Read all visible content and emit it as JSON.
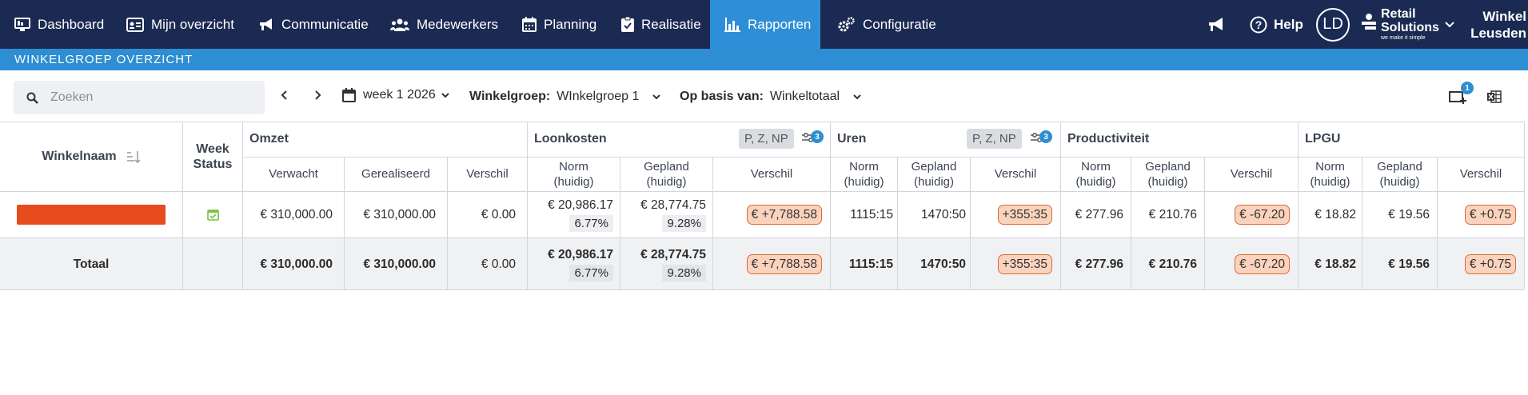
{
  "nav": {
    "items": [
      {
        "label": "Dashboard",
        "icon": "monitor-icon"
      },
      {
        "label": "Mijn overzicht",
        "icon": "id-card-icon"
      },
      {
        "label": "Communicatie",
        "icon": "megaphone-icon"
      },
      {
        "label": "Medewerkers",
        "icon": "users-icon"
      },
      {
        "label": "Planning",
        "icon": "calendar-icon"
      },
      {
        "label": "Realisatie",
        "icon": "clipboard-check-icon"
      },
      {
        "label": "Rapporten",
        "icon": "bar-chart-icon",
        "active": true
      },
      {
        "label": "Configuratie",
        "icon": "gears-icon"
      }
    ],
    "help_label": "Help",
    "avatar_initials": "LD",
    "brand_line1": "Retail",
    "brand_line2": "Solutions",
    "brand_tagline": "we make it simple",
    "store_line1": "Winkel",
    "store_line2": "Leusden"
  },
  "page": {
    "title": "WINKELGROEP OVERZICHT"
  },
  "toolbar": {
    "search_placeholder": "Zoeken",
    "week_label": "week 1 2026",
    "winkelgroep_label": "Winkelgroep:",
    "winkelgroep_value": "WInkelgroep 1",
    "basis_label": "Op basis van:",
    "basis_value": "Winkeltotaal",
    "notification_count": "1"
  },
  "table": {
    "col_winkelnaam": "Winkelnaam",
    "col_week": "Week",
    "col_status": "Status",
    "groups": {
      "omzet": "Omzet",
      "loonkosten": "Loonkosten",
      "uren": "Uren",
      "productiviteit": "Productiviteit",
      "lpgu": "LPGU"
    },
    "filter_chip": "P, Z, NP",
    "filter_count": "3",
    "sub": {
      "verwacht": "Verwacht",
      "gerealiseerd": "Gerealiseerd",
      "verschil": "Verschil",
      "norm1": "Norm",
      "norm2": "(huidig)",
      "gepland1": "Gepland",
      "gepland2": "(huidig)"
    },
    "row": {
      "omzet_verwacht": "€ 310,000.00",
      "omzet_gerealiseerd": "€ 310,000.00",
      "omzet_verschil": "€ 0.00",
      "lk_norm": "€ 20,986.17",
      "lk_norm_pct": "6.77%",
      "lk_gepland": "€ 28,774.75",
      "lk_gepland_pct": "9.28%",
      "lk_verschil": "€ +7,788.58",
      "uren_norm": "1115:15",
      "uren_gepland": "1470:50",
      "uren_verschil": "+355:35",
      "prod_norm": "€ 277.96",
      "prod_gepland": "€ 210.76",
      "prod_verschil": "€ -67.20",
      "lpgu_norm": "€ 18.82",
      "lpgu_gepland": "€ 19.56",
      "lpgu_verschil": "€ +0.75"
    },
    "total": {
      "label": "Totaal",
      "omzet_verwacht": "€ 310,000.00",
      "omzet_gerealiseerd": "€ 310,000.00",
      "omzet_verschil": "€ 0.00",
      "lk_norm": "€ 20,986.17",
      "lk_norm_pct": "6.77%",
      "lk_gepland": "€ 28,774.75",
      "lk_gepland_pct": "9.28%",
      "lk_verschil": "€ +7,788.58",
      "uren_norm": "1115:15",
      "uren_gepland": "1470:50",
      "uren_verschil": "+355:35",
      "prod_norm": "€ 277.96",
      "prod_gepland": "€ 210.76",
      "prod_verschil": "€ -67.20",
      "lpgu_norm": "€ 18.82",
      "lpgu_gepland": "€ 19.56",
      "lpgu_verschil": "€ +0.75"
    }
  },
  "colors": {
    "nav": "#1b2a52",
    "accent": "#2d8ed3",
    "redacted": "#e84c1e",
    "pill_bg": "#fbd3bd",
    "pill_border": "#d86a3a",
    "status_green": "#7cc142"
  }
}
